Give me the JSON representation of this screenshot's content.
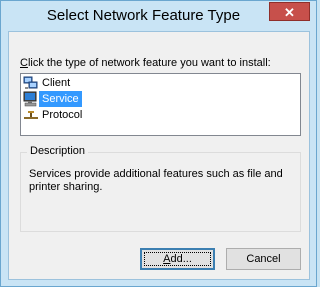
{
  "window": {
    "title": "Select Network Feature Type",
    "close_label": "✕"
  },
  "prompt": {
    "accel": "C",
    "rest": "lick the type of network feature you want to install:"
  },
  "list": {
    "items": [
      {
        "label": "Client",
        "icon": "client-icon",
        "selected": false
      },
      {
        "label": "Service",
        "icon": "service-icon",
        "selected": true
      },
      {
        "label": "Protocol",
        "icon": "protocol-icon",
        "selected": false
      }
    ]
  },
  "description": {
    "heading": "Description",
    "text": "Services provide additional features such as file and printer sharing."
  },
  "buttons": {
    "add_accel": "A",
    "add_rest": "dd...",
    "cancel": "Cancel"
  },
  "colors": {
    "selection": "#3399ff",
    "close_button": "#c7504b",
    "frame": "#c9e4f5"
  }
}
